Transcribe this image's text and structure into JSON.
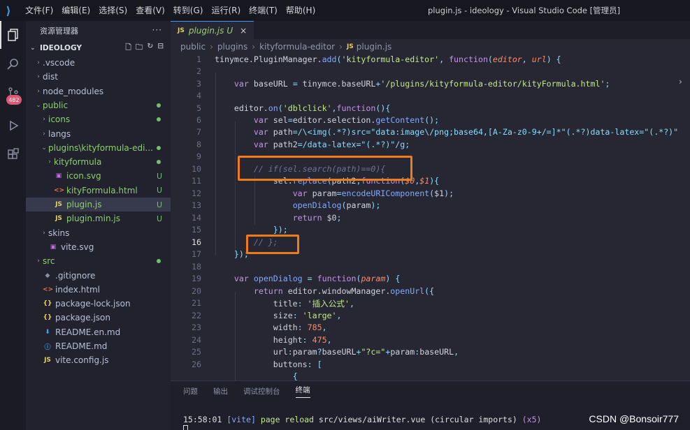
{
  "window": {
    "title": "plugin.js - ideology - Visual Studio Code [管理员]"
  },
  "menu": [
    "文件(F)",
    "编辑(E)",
    "选择(S)",
    "查看(V)",
    "转到(G)",
    "运行(R)",
    "终端(T)",
    "帮助(H)"
  ],
  "activity": {
    "scm_badge": "482"
  },
  "sidebar": {
    "title": "资源管理器",
    "more": "···",
    "project": "IDEOLOGY",
    "items": [
      {
        "label": ".vscode",
        "twisty": "›",
        "icon": "",
        "status": ""
      },
      {
        "label": "dist",
        "twisty": "›",
        "icon": "",
        "status": ""
      },
      {
        "label": "node_modules",
        "twisty": "›",
        "icon": "",
        "status": ""
      },
      {
        "label": "public",
        "twisty": "⌄",
        "icon": "",
        "status": "dot"
      },
      {
        "label": "icons",
        "twisty": "›",
        "icon": "",
        "status": "dot"
      },
      {
        "label": "langs",
        "twisty": "›",
        "icon": "",
        "status": ""
      },
      {
        "label": "plugins\\kityformula-edi...",
        "twisty": "⌄",
        "icon": "",
        "status": "dot"
      },
      {
        "label": "kityformula",
        "twisty": "›",
        "icon": "",
        "status": "dot"
      },
      {
        "label": "icon.svg",
        "twisty": "",
        "icon": "svg",
        "status": "U"
      },
      {
        "label": "kityFormula.html",
        "twisty": "",
        "icon": "html",
        "status": "U"
      },
      {
        "label": "plugin.js",
        "twisty": "",
        "icon": "JS",
        "status": "U"
      },
      {
        "label": "plugin.min.js",
        "twisty": "",
        "icon": "JS",
        "status": "U"
      },
      {
        "label": "skins",
        "twisty": "›",
        "icon": "",
        "status": ""
      },
      {
        "label": "vite.svg",
        "twisty": "",
        "icon": "svg",
        "status": ""
      },
      {
        "label": "src",
        "twisty": "›",
        "icon": "",
        "status": "dot"
      },
      {
        "label": ".gitignore",
        "twisty": "",
        "icon": "git",
        "status": ""
      },
      {
        "label": "index.html",
        "twisty": "",
        "icon": "html",
        "status": ""
      },
      {
        "label": "package-lock.json",
        "twisty": "",
        "icon": "{}",
        "status": ""
      },
      {
        "label": "package.json",
        "twisty": "",
        "icon": "{}",
        "status": ""
      },
      {
        "label": "README.en.md",
        "twisty": "",
        "icon": "md",
        "status": ""
      },
      {
        "label": "README.md",
        "twisty": "",
        "icon": "info",
        "status": ""
      },
      {
        "label": "vite.config.js",
        "twisty": "",
        "icon": "JS",
        "status": ""
      }
    ]
  },
  "editor": {
    "tab": {
      "icon": "JS",
      "label": "plugin.js",
      "status": "U",
      "close": "×"
    },
    "breadcrumb": [
      "public",
      "plugins",
      "kityformula-editor",
      "plugin.js"
    ],
    "lines": [
      "1",
      "2",
      "3",
      "4",
      "5",
      "6",
      "7",
      "8",
      "9",
      "10",
      "11",
      "12",
      "13",
      "14",
      "15",
      "16",
      "17",
      "18",
      "19",
      "20",
      "21",
      "22",
      "23",
      "24",
      "25",
      "26"
    ]
  },
  "panel": {
    "tabs": [
      "问题",
      "输出",
      "调试控制台",
      "终端"
    ],
    "active_tab": "终端",
    "terminal": {
      "time": "15:58:01",
      "tag": "[vite]",
      "msg1": "page reload",
      "path": "src/views/aiWriter.vue",
      "msg2": "(circular imports)",
      "count": "(x5)"
    }
  },
  "watermark": "CSDN @Bonsoir777",
  "colors": {
    "accent": "#3b9ef5",
    "highlight_box": "#f07b1a",
    "git_untracked": "#71c06a"
  }
}
